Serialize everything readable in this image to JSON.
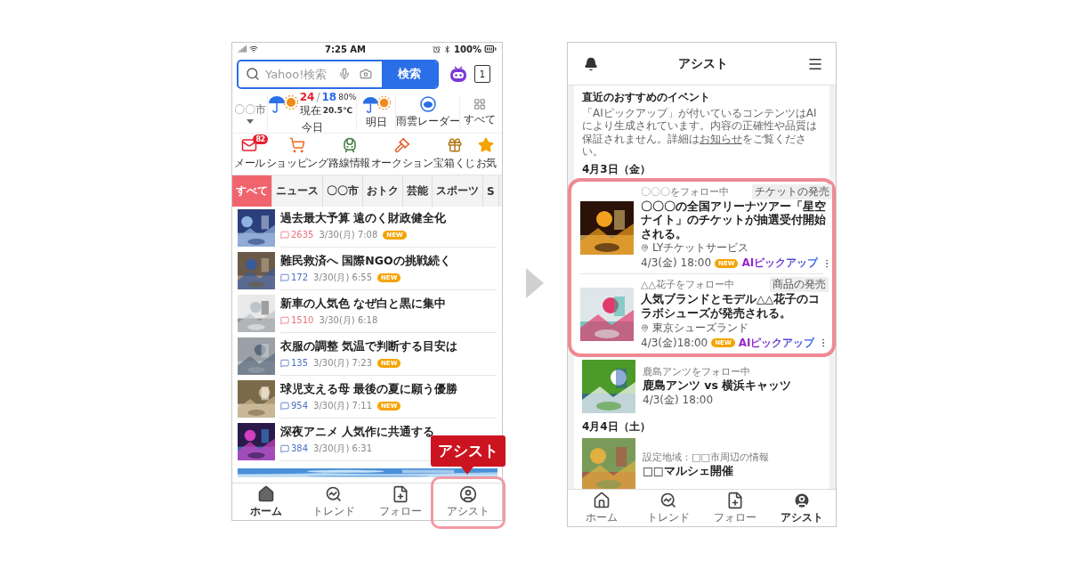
{
  "left_phone": {
    "status_bar": {
      "time": "7:25 AM",
      "battery": "100%"
    },
    "search": {
      "placeholder": "Yahoo!検索",
      "button": "検索",
      "tab_count": "1"
    },
    "weather": {
      "location": "〇〇市",
      "today": "今日",
      "high": "24",
      "separator": "/",
      "low": "18",
      "precip": "80%",
      "now_label": "現在",
      "now_temp": "20.5℃",
      "tomorrow": "明日",
      "radar": "雨雲レーダー",
      "all": "すべて"
    },
    "services": [
      {
        "kind": "mail",
        "label": "メール",
        "badge": "82"
      },
      {
        "kind": "cart",
        "label": "ショッピング"
      },
      {
        "kind": "train",
        "label": "路線情報"
      },
      {
        "kind": "gavel",
        "label": "オークション"
      },
      {
        "kind": "chest",
        "label": "宝箱くじ"
      },
      {
        "kind": "star",
        "label": "お気"
      }
    ],
    "categories": [
      {
        "label": "すべて",
        "selected": true
      },
      {
        "label": "ニュース",
        "selected": false
      },
      {
        "label": "〇〇市",
        "selected": false
      },
      {
        "label": "おトク",
        "selected": false
      },
      {
        "label": "芸能",
        "selected": false
      },
      {
        "label": "スポーツ",
        "selected": false
      },
      {
        "label": "S",
        "selected": false
      }
    ],
    "articles": [
      {
        "title": "過去最大予算 遠のく財政健全化",
        "comments": "2635",
        "hot": true,
        "date": "3/30(月) 7:08",
        "badge": "NEW"
      },
      {
        "title": "難民救済へ 国際NGOの挑戦続く",
        "comments": "172",
        "hot": false,
        "date": "3/30(月) 6:55",
        "badge": "NEW"
      },
      {
        "title": "新車の人気色 なぜ白と黒に集中",
        "comments": "1510",
        "hot": true,
        "date": "3/30(月) 6:18"
      },
      {
        "title": "衣服の調整 気温で判断する目安は",
        "comments": "135",
        "hot": false,
        "date": "3/30(月) 7:23",
        "badge": "NEW"
      },
      {
        "title": "球児支える母 最後の夏に願う優勝",
        "comments": "954",
        "hot": false,
        "date": "3/30(月) 7:11",
        "badge": "NEW"
      },
      {
        "title": "深夜アニメ 人気作に共通する",
        "comments": "384",
        "hot": false,
        "date": "3/30(月) 6:31"
      }
    ],
    "nav": [
      {
        "kind": "home",
        "label": "ホーム",
        "selected": true,
        "highlighted": false
      },
      {
        "kind": "trend",
        "label": "トレンド",
        "selected": false,
        "highlighted": false
      },
      {
        "kind": "follow",
        "label": "フォロー",
        "selected": false,
        "highlighted": false
      },
      {
        "kind": "assist",
        "label": "アシスト",
        "selected": false,
        "highlighted": true
      }
    ],
    "callout": "アシスト"
  },
  "right_phone": {
    "title": "アシスト",
    "section_title": "直近のおすすめのイベント",
    "notice": {
      "before": "「AIピックアップ」が付いているコンテンツはAIにより生成されています。内容の正確性や品質は保証されません。詳細は",
      "link": "お知らせ",
      "after": "をご覧ください。"
    },
    "days": [
      {
        "date": "4月3日（金）",
        "events": [
          {
            "follow": "〇〇〇をフォロー中",
            "tag": "チケットの発売",
            "title": "〇〇〇の全国アリーナツアー「星空ナイト」のチケットが抽選受付開始される。",
            "place": "LYチケットサービス",
            "time": "4/3(金) 18:00",
            "badge": "NEW",
            "ai_label": "AIピックアップ",
            "highlighted": true
          },
          {
            "follow": "△△花子をフォロー中",
            "tag": "商品の発売",
            "title": "人気ブランドとモデル△△花子のコラボシューズが発売される。",
            "place": "東京シューズランド",
            "time": "4/3(金)18:00",
            "badge": "NEW",
            "ai_label": "AIピックアップ",
            "highlighted": true
          },
          {
            "follow": "鹿島アンツをフォロー中",
            "title": "鹿島アンツ vs 横浜キャッツ",
            "time": "4/3(金) 18:00",
            "highlighted": false
          }
        ]
      },
      {
        "date": "4月4日（土）",
        "events": [
          {
            "follow": "設定地域：□□市周辺の情報",
            "title": "□□マルシェ開催",
            "highlighted": false
          }
        ]
      }
    ],
    "nav": [
      {
        "kind": "home",
        "label": "ホーム",
        "selected": false
      },
      {
        "kind": "trend",
        "label": "トレンド",
        "selected": false
      },
      {
        "kind": "follow",
        "label": "フォロー",
        "selected": false
      },
      {
        "kind": "assist",
        "label": "アシスト",
        "selected": true
      }
    ]
  }
}
